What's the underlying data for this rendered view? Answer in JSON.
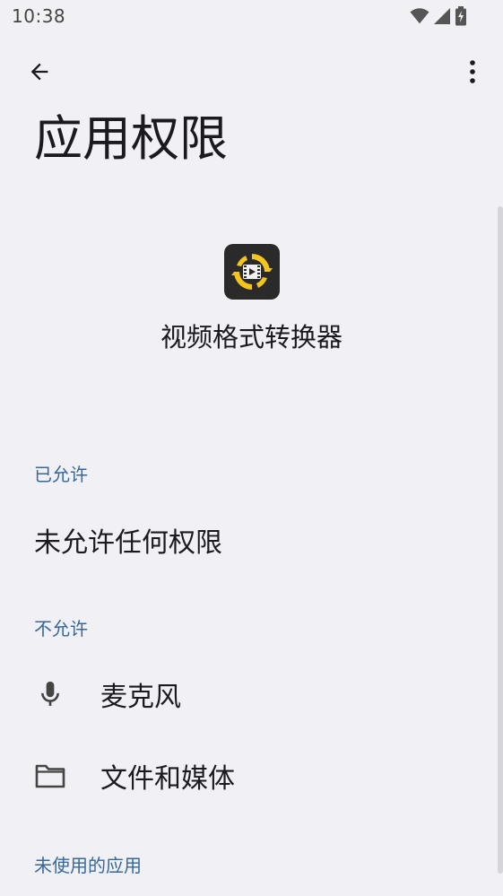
{
  "status_bar": {
    "time": "10:38",
    "icons": [
      "wifi-icon",
      "signal-icon",
      "battery-charging-icon"
    ]
  },
  "toolbar": {
    "back_icon": "arrow-back-icon",
    "more_icon": "more-vert-icon"
  },
  "page": {
    "title": "应用权限"
  },
  "app": {
    "name": "视频格式转换器",
    "icon": "video-converter-app-icon",
    "icon_colors": {
      "background": "#2a2a2a",
      "ring": "#f4c51c"
    }
  },
  "sections": {
    "allowed": {
      "header": "已允许",
      "empty_text": "未允许任何权限"
    },
    "denied": {
      "header": "不允许",
      "items": [
        {
          "label": "麦克风",
          "icon": "microphone-icon"
        },
        {
          "label": "文件和媒体",
          "icon": "folder-icon"
        }
      ]
    },
    "unused": {
      "header": "未使用的应用"
    }
  },
  "colors": {
    "background": "#f1f0f5",
    "section_header": "#36689c",
    "text_primary": "#1b1b1f"
  }
}
